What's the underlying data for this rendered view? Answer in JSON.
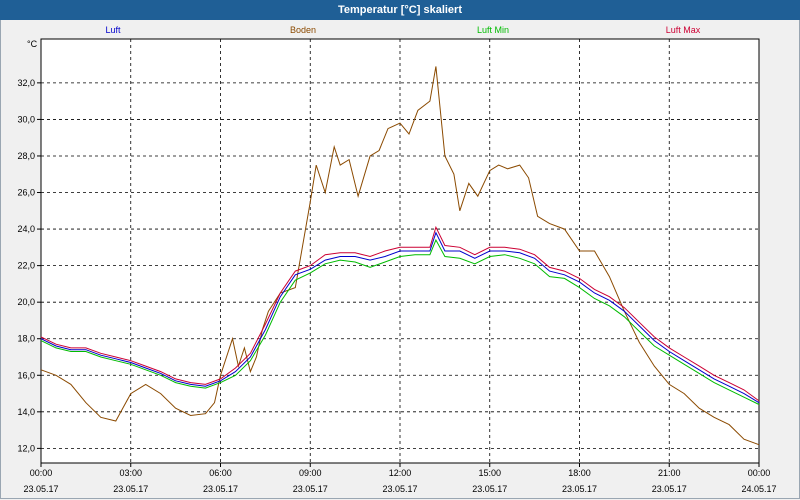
{
  "window": {
    "title": "Temperatur [°C] skaliert"
  },
  "colors": {
    "titlebar": "#1f5f96",
    "plot_bg": "#ffffff",
    "grid": "#000000"
  },
  "chart_data": {
    "type": "line",
    "ylabel": "°C",
    "ylim": [
      11.2,
      34.4
    ],
    "xlim_hours": [
      0,
      24
    ],
    "grid": true,
    "legend_placement": "top",
    "yticks": [
      "12,0",
      "14,0",
      "16,0",
      "18,0",
      "20,0",
      "22,0",
      "24,0",
      "26,0",
      "28,0",
      "30,0",
      "32,0"
    ],
    "yticks_values": [
      12,
      14,
      16,
      18,
      20,
      22,
      24,
      26,
      28,
      30,
      32
    ],
    "xticks": [
      {
        "time": "00:00",
        "date": "23.05.17"
      },
      {
        "time": "03:00",
        "date": "23.05.17"
      },
      {
        "time": "06:00",
        "date": "23.05.17"
      },
      {
        "time": "09:00",
        "date": "23.05.17"
      },
      {
        "time": "12:00",
        "date": "23.05.17"
      },
      {
        "time": "15:00",
        "date": "23.05.17"
      },
      {
        "time": "18:00",
        "date": "23.05.17"
      },
      {
        "time": "21:00",
        "date": "23.05.17"
      },
      {
        "time": "00:00",
        "date": "24.05.17"
      }
    ],
    "xticks_hours": [
      0,
      3,
      6,
      9,
      12,
      15,
      18,
      21,
      24
    ],
    "series": [
      {
        "name": "Luft",
        "color": "#0000cc",
        "x": [
          0,
          0.5,
          1,
          1.5,
          2,
          2.5,
          3,
          3.5,
          4,
          4.5,
          5,
          5.5,
          6,
          6.5,
          7,
          7.5,
          8,
          8.5,
          9,
          9.5,
          10,
          10.5,
          11,
          11.5,
          12,
          12.5,
          13,
          13.2,
          13.5,
          14,
          14.5,
          15,
          15.5,
          16,
          16.5,
          17,
          17.5,
          18,
          18.5,
          19,
          19.5,
          20,
          20.5,
          21,
          21.5,
          22,
          22.5,
          23,
          23.5,
          24
        ],
        "y": [
          18.0,
          17.6,
          17.4,
          17.4,
          17.1,
          16.9,
          16.7,
          16.4,
          16.1,
          15.7,
          15.5,
          15.4,
          15.7,
          16.2,
          17.0,
          18.5,
          20.3,
          21.5,
          21.8,
          22.3,
          22.5,
          22.5,
          22.3,
          22.5,
          22.8,
          22.8,
          22.8,
          23.8,
          22.8,
          22.8,
          22.4,
          22.8,
          22.8,
          22.7,
          22.4,
          21.7,
          21.5,
          21.1,
          20.5,
          20.1,
          19.5,
          18.7,
          17.9,
          17.3,
          16.8,
          16.3,
          15.8,
          15.4,
          15.0,
          14.5
        ]
      },
      {
        "name": "Boden",
        "color": "#8b4a00",
        "x": [
          0,
          0.5,
          1,
          1.5,
          2,
          2.5,
          3,
          3.5,
          4,
          4.5,
          5,
          5.5,
          5.8,
          6,
          6.2,
          6.4,
          6.6,
          6.8,
          7,
          7.2,
          7.4,
          7.6,
          8,
          8.5,
          9,
          9.2,
          9.5,
          9.8,
          10,
          10.3,
          10.6,
          11,
          11.3,
          11.6,
          12,
          12.3,
          12.6,
          13,
          13.2,
          13.5,
          13.8,
          14,
          14.3,
          14.6,
          15,
          15.3,
          15.6,
          16,
          16.3,
          16.6,
          17,
          17.5,
          18,
          18.5,
          19,
          19.5,
          20,
          20.5,
          21,
          21.5,
          22,
          22.5,
          23,
          23.5,
          24
        ],
        "y": [
          16.3,
          16.0,
          15.5,
          14.5,
          13.7,
          13.5,
          15.0,
          15.5,
          15.0,
          14.2,
          13.8,
          13.9,
          14.5,
          16.0,
          17.0,
          18.0,
          16.5,
          17.5,
          16.2,
          17.0,
          18.5,
          19.5,
          20.5,
          20.8,
          25.5,
          27.5,
          26.0,
          28.5,
          27.5,
          27.8,
          25.8,
          28.0,
          28.3,
          29.5,
          29.8,
          29.2,
          30.5,
          31.0,
          32.9,
          28.0,
          27.0,
          25.0,
          26.5,
          25.8,
          27.2,
          27.5,
          27.3,
          27.5,
          26.8,
          24.7,
          24.3,
          24.0,
          22.8,
          22.8,
          21.4,
          19.5,
          17.8,
          16.5,
          15.5,
          15.0,
          14.2,
          13.7,
          13.3,
          12.5,
          12.2
        ]
      },
      {
        "name": "Luft Min",
        "color": "#00bb00",
        "x": [
          0,
          0.5,
          1,
          1.5,
          2,
          2.5,
          3,
          3.5,
          4,
          4.5,
          5,
          5.5,
          6,
          6.5,
          7,
          7.5,
          8,
          8.5,
          9,
          9.5,
          10,
          10.5,
          11,
          11.5,
          12,
          12.5,
          13,
          13.2,
          13.5,
          14,
          14.5,
          15,
          15.5,
          16,
          16.5,
          17,
          17.5,
          18,
          18.5,
          19,
          19.5,
          20,
          20.5,
          21,
          21.5,
          22,
          22.5,
          23,
          23.5,
          24
        ],
        "y": [
          17.9,
          17.5,
          17.3,
          17.3,
          17.0,
          16.8,
          16.6,
          16.3,
          16.0,
          15.6,
          15.4,
          15.3,
          15.6,
          16.0,
          16.8,
          18.2,
          20.0,
          21.2,
          21.6,
          22.1,
          22.3,
          22.2,
          21.9,
          22.2,
          22.5,
          22.6,
          22.6,
          23.4,
          22.5,
          22.4,
          22.1,
          22.5,
          22.6,
          22.4,
          22.1,
          21.4,
          21.3,
          20.8,
          20.2,
          19.8,
          19.2,
          18.4,
          17.6,
          17.1,
          16.6,
          16.1,
          15.6,
          15.2,
          14.8,
          14.4
        ]
      },
      {
        "name": "Luft Max",
        "color": "#cc0033",
        "x": [
          0,
          0.5,
          1,
          1.5,
          2,
          2.5,
          3,
          3.5,
          4,
          4.5,
          5,
          5.5,
          6,
          6.5,
          7,
          7.5,
          8,
          8.5,
          9,
          9.5,
          10,
          10.5,
          11,
          11.5,
          12,
          12.5,
          13,
          13.2,
          13.5,
          14,
          14.5,
          15,
          15.5,
          16,
          16.5,
          17,
          17.5,
          18,
          18.5,
          19,
          19.5,
          20,
          20.5,
          21,
          21.5,
          22,
          22.5,
          23,
          23.5,
          24
        ],
        "y": [
          18.1,
          17.7,
          17.5,
          17.5,
          17.2,
          17.0,
          16.8,
          16.5,
          16.2,
          15.8,
          15.6,
          15.5,
          15.8,
          16.4,
          17.2,
          18.8,
          20.5,
          21.7,
          22.0,
          22.6,
          22.7,
          22.7,
          22.5,
          22.8,
          23.0,
          23.0,
          23.0,
          24.1,
          23.1,
          23.0,
          22.6,
          23.0,
          23.0,
          22.9,
          22.6,
          21.9,
          21.7,
          21.3,
          20.7,
          20.3,
          19.7,
          18.9,
          18.1,
          17.5,
          17.0,
          16.5,
          16.0,
          15.6,
          15.2,
          14.6
        ]
      }
    ]
  }
}
